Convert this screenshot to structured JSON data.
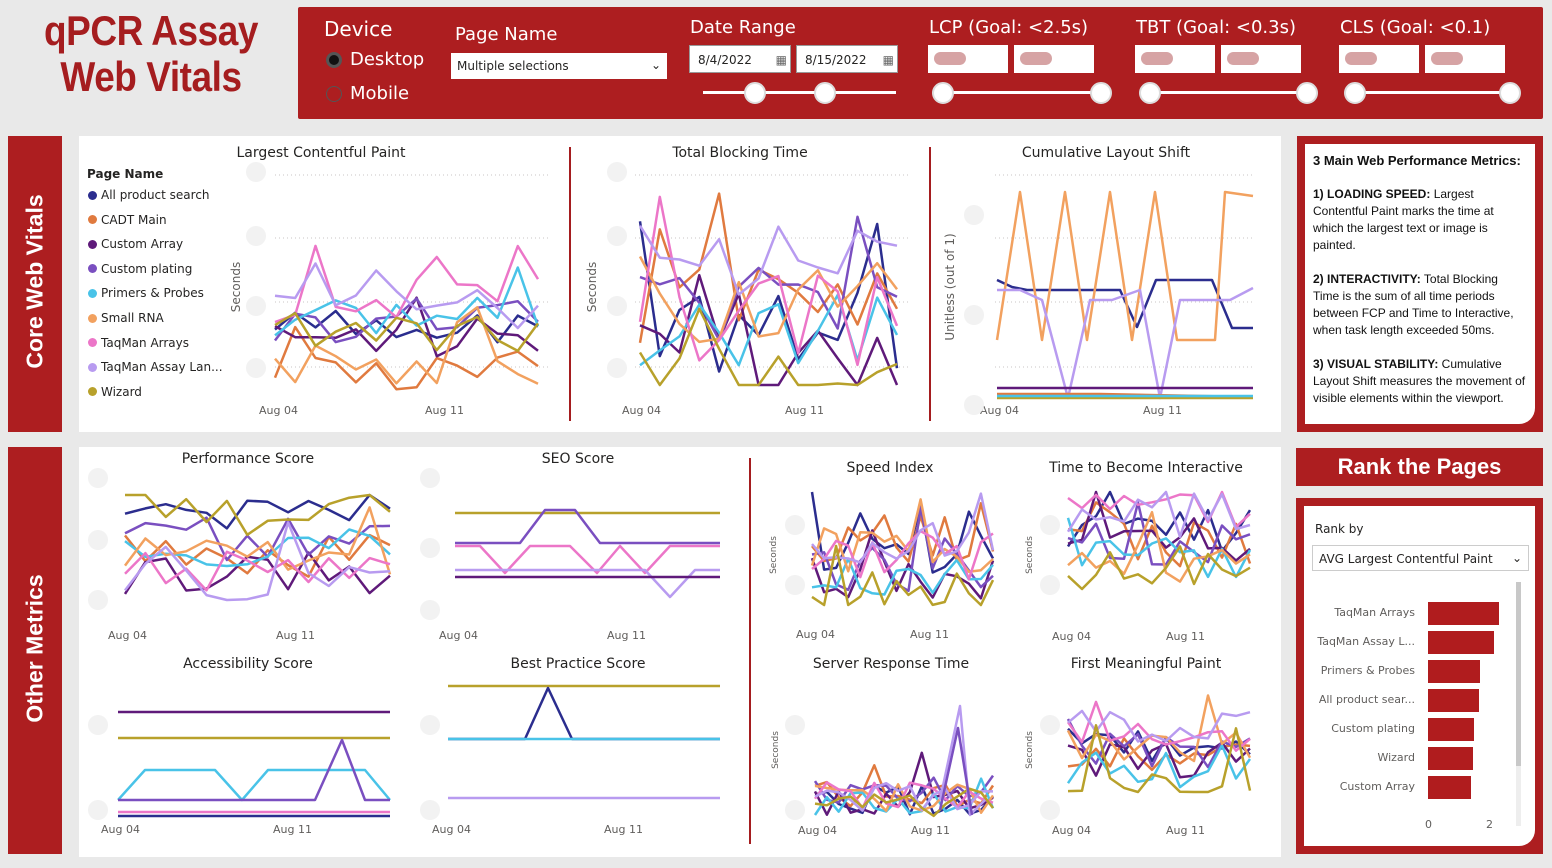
{
  "title": {
    "line1": "qPCR Assay",
    "line2": "Web Vitals"
  },
  "filters": {
    "device": {
      "label": "Device",
      "options": [
        "Desktop",
        "Mobile"
      ],
      "selected": "Desktop"
    },
    "page_name": {
      "label": "Page Name",
      "value": "Multiple selections"
    },
    "date_range": {
      "label": "Date Range",
      "start": "8/4/2022",
      "end": "8/15/2022"
    },
    "lcp": {
      "label": "LCP (Goal: <2.5s)"
    },
    "tbt": {
      "label": "TBT (Goal: <0.3s)"
    },
    "cls": {
      "label": "CLS (Goal: <0.1)"
    }
  },
  "sections": {
    "core": "Core Web Vitals",
    "other": "Other Metrics"
  },
  "legend": {
    "title": "Page Name",
    "items": [
      {
        "label": "All product search",
        "color": "#2b2d8e"
      },
      {
        "label": "CADT Main",
        "color": "#e07a3f"
      },
      {
        "label": "Custom Array",
        "color": "#5f1a7a"
      },
      {
        "label": "Custom plating",
        "color": "#7a4fc0"
      },
      {
        "label": "Primers & Probes",
        "color": "#49c3e8"
      },
      {
        "label": "Small RNA",
        "color": "#f2a15f"
      },
      {
        "label": "TaqMan Arrays",
        "color": "#ec76c8"
      },
      {
        "label": "TaqMan Assay Lan...",
        "color": "#b89bf0"
      },
      {
        "label": "Wizard",
        "color": "#b8a12b"
      }
    ]
  },
  "x_ticks": [
    "Aug 04",
    "Aug 11"
  ],
  "charts": {
    "lcp": {
      "title": "Largest Contentful Paint",
      "ylabel": "Seconds"
    },
    "tbt": {
      "title": "Total Blocking Time",
      "ylabel": "Seconds"
    },
    "cls": {
      "title": "Cumulative Layout Shift",
      "ylabel": "Unitless (out of 1)"
    },
    "perf": {
      "title": "Performance Score"
    },
    "seo": {
      "title": "SEO Score"
    },
    "access": {
      "title": "Accessibility Score"
    },
    "best": {
      "title": "Best Practice Score"
    },
    "speed": {
      "title": "Speed Index",
      "ylabel": "Seconds"
    },
    "tti": {
      "title": "Time to Become Interactive",
      "ylabel": "Seconds"
    },
    "srt": {
      "title": "Server Response Time",
      "ylabel": "Seconds"
    },
    "fmp": {
      "title": "First Meaningful Paint",
      "ylabel": "Seconds"
    }
  },
  "info": {
    "heading": "3 Main Web Performance Metrics:",
    "items": [
      {
        "bold": "1) LOADING SPEED:",
        "text": " Largest Contentful Paint marks the time at which the largest text or image is painted."
      },
      {
        "bold": "2) INTERACTIVITY:",
        "text": " Total Blocking Time is the sum of all time periods between FCP and Time to Interactive, when task length exceeded 50ms."
      },
      {
        "bold": "3) VISUAL STABILITY:",
        "text": " Cumulative Layout Shift measures the movement of visible elements within the viewport."
      }
    ]
  },
  "rank": {
    "header": "Rank the Pages",
    "rank_by_label": "Rank by",
    "rank_by_value": "AVG Largest Contentful Paint",
    "axis_ticks": [
      "0",
      "2"
    ]
  },
  "chart_data": [
    {
      "type": "bar",
      "title": "",
      "categories": [
        "TaqMan Arrays",
        "TaqMan Assay L...",
        "Primers & Probes",
        "All product sear...",
        "Custom plating",
        "Wizard",
        "Custom Array"
      ],
      "values": [
        2.3,
        2.15,
        1.7,
        1.65,
        1.5,
        1.45,
        1.4
      ],
      "xlim": [
        0,
        2.6
      ],
      "color": "#b01c1e"
    },
    {
      "type": "line",
      "title": "Largest Contentful Paint",
      "ylabel": "Seconds",
      "x": [
        "Aug 04",
        "Aug 11"
      ]
    },
    {
      "type": "line",
      "title": "Total Blocking Time",
      "ylabel": "Seconds",
      "x": [
        "Aug 04",
        "Aug 11"
      ]
    },
    {
      "type": "line",
      "title": "Cumulative Layout Shift",
      "ylabel": "Unitless (out of 1)",
      "x": [
        "Aug 04",
        "Aug 11"
      ]
    }
  ]
}
